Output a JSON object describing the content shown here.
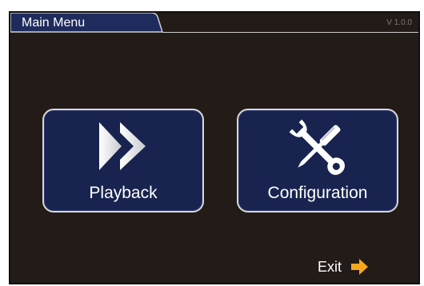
{
  "window": {
    "title": "Main Menu",
    "version": "V 1.0.0"
  },
  "menu": {
    "items": [
      {
        "label": "Playback",
        "icon": "fast-forward-icon"
      },
      {
        "label": "Configuration",
        "icon": "wrench-screwdriver-icon"
      }
    ],
    "exit_label": "Exit",
    "exit_icon": "arrow-right-icon"
  },
  "colors": {
    "background": "#231b18",
    "button_fill": "#18244f",
    "button_border": "#d8d8d8",
    "tab_fill": "#1e2b5c",
    "exit_arrow": "#f5a81d"
  }
}
